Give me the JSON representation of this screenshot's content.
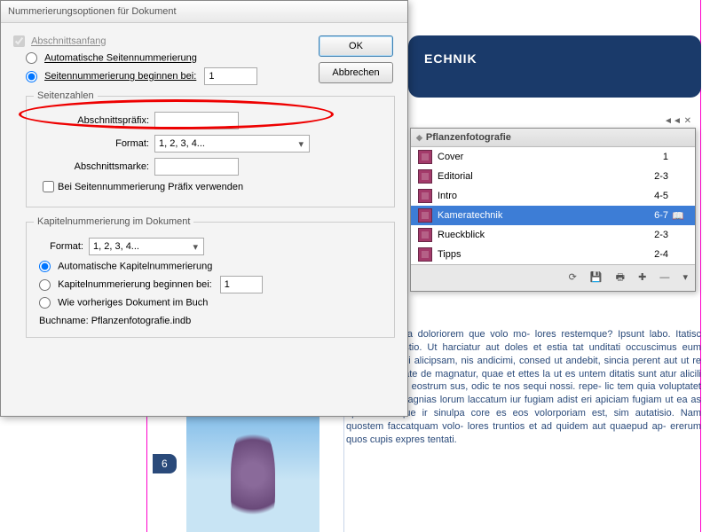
{
  "background": {
    "header_text": "ECHNIK",
    "page_number": "6",
    "paragraph": "him et rehenia doloriorem que volo mo-\nlores restemque? Ipsunt labo. Itatisc illores\nut ratistio. Ut harciatur aut doles et estia\ntat unditati occuscimus eum nosam lab\niqui alicipsam, nis andicimi, consed ut\nandebit, sincia perent aut ut re et ex el-\nlab late de magnatur, quae et ettes la ut\nes untem ditatis sunt atur alicili beatius, odi\net eostrum sus, odic te nos sequi nossi. repe-\nlic tem quia voluptatet lit aut veles magnias\nlorum laccatum iur fugiam adist\neri apiciam fugiam ut ea as apidi nonseque\nir sinulpa core es eos volorporiam est, sim\nautatisio. Nam quostem faccatquam volo-\nlores truntios et ad quidem aut quaepud ap-\nererum quos cupis expres tentati."
  },
  "dialog": {
    "title": "Nummerierungsoptionen für Dokument",
    "section_start": "Abschnittsanfang",
    "auto_page": "Automatische Seitennummerierung",
    "start_at_label": "Seitennummerierung beginnen bei:",
    "start_at_value": "1",
    "page_numbers_legend": "Seitenzahlen",
    "prefix_label": "Abschnittspräfix:",
    "prefix_value": "",
    "format_label": "Format:",
    "format_value": "1, 2, 3, 4...",
    "marker_label": "Abschnittsmarke:",
    "marker_value": "",
    "use_prefix": "Bei Seitennummerierung Präfix verwenden",
    "chapter_legend": "Kapitelnummerierung im Dokument",
    "ch_format_label": "Format:",
    "ch_format_value": "1, 2, 3, 4...",
    "ch_auto": "Automatische Kapitelnummerierung",
    "ch_start": "Kapitelnummerierung beginnen bei:",
    "ch_start_value": "1",
    "ch_prev": "Wie vorheriges Dokument im Buch",
    "bookname_label": "Buchname:",
    "bookname_value": "Pflanzenfotografie.indb",
    "ok": "OK",
    "cancel": "Abbrechen"
  },
  "panel": {
    "title": "Pflanzenfotografie",
    "rows": [
      {
        "name": "Cover",
        "pages": "1"
      },
      {
        "name": "Editorial",
        "pages": "2-3"
      },
      {
        "name": "Intro",
        "pages": "4-5"
      },
      {
        "name": "Kameratechnik",
        "pages": "6-7",
        "selected": true,
        "open": true
      },
      {
        "name": "Rueckblick",
        "pages": "2-3"
      },
      {
        "name": "Tipps",
        "pages": "2-4"
      }
    ],
    "footer_icons": [
      "sync-icon",
      "save-icon",
      "print-icon",
      "add-icon",
      "remove-icon"
    ]
  }
}
